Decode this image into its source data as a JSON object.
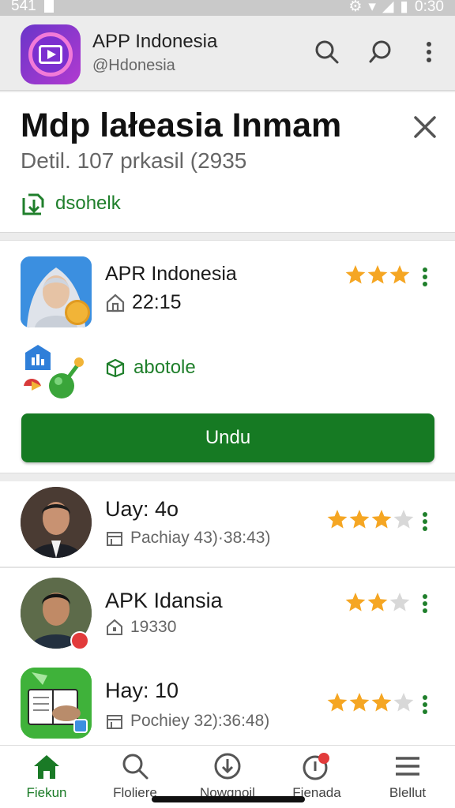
{
  "status_bar": {
    "time_left": "541",
    "time_right": "0:30"
  },
  "app_bar": {
    "title": "APP Indonesia",
    "handle": "@Hdonesia",
    "icons": [
      "search-icon",
      "chat-icon",
      "more-vert-icon"
    ]
  },
  "header": {
    "title": "Mdp lałeasia Inmam",
    "subtitle": "Detil. 107 prkasil (2935",
    "link_label": "dsohelk"
  },
  "featured": {
    "name": "APR Indonesia",
    "time": "22:15",
    "rating": 3,
    "tag": "abotole",
    "download_label": "Undu"
  },
  "list": [
    {
      "name": "Uay: 4o",
      "meta": "Pachiay 43)·38:43)",
      "rating": 3,
      "rating_max": 4
    },
    {
      "name": "APK Idansia",
      "meta": "19330",
      "rating": 2,
      "rating_max": 3
    },
    {
      "name": "Hay: 10",
      "meta": "Pochiey 32):36:48)",
      "rating": 3,
      "rating_max": 4
    }
  ],
  "bottom_nav": [
    {
      "label": "Fiekun",
      "icon": "home-icon",
      "active": true
    },
    {
      "label": "Floliere",
      "icon": "search-icon",
      "active": false
    },
    {
      "label": "Nowgnoil",
      "icon": "download-icon",
      "active": false
    },
    {
      "label": "Fienada",
      "icon": "notification-icon",
      "active": false
    },
    {
      "label": "Blellut",
      "icon": "menu-icon",
      "active": false
    }
  ],
  "colors": {
    "accent": "#167a23",
    "star": "#f5a623",
    "star_empty": "#d8d8d8",
    "link": "#1f7f2b"
  }
}
